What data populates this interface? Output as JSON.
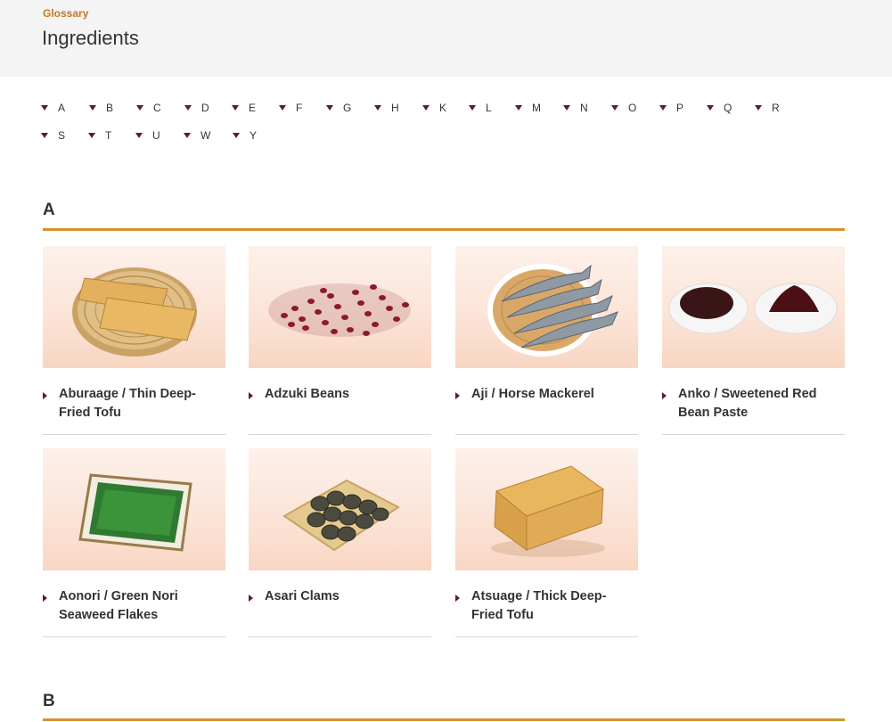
{
  "header": {
    "eyebrow": "Glossary",
    "title": "Ingredients"
  },
  "alphabet": {
    "row1": [
      "A",
      "B",
      "C",
      "D",
      "E",
      "F",
      "G",
      "H",
      "K",
      "L",
      "M",
      "N",
      "O",
      "P",
      "Q",
      "R"
    ],
    "row2": [
      "S",
      "T",
      "U",
      "W",
      "Y"
    ]
  },
  "sections": [
    {
      "letter": "A",
      "items": [
        {
          "label": "Aburaage / Thin Deep-Fried Tofu",
          "image": "aburaage-photo"
        },
        {
          "label": "Adzuki Beans",
          "image": "adzuki-photo"
        },
        {
          "label": "Aji / Horse Mackerel",
          "image": "aji-photo"
        },
        {
          "label": "Anko / Sweetened Red Bean Paste",
          "image": "anko-photo"
        },
        {
          "label": "Aonori / Green Nori Seaweed Flakes",
          "image": "aonori-photo"
        },
        {
          "label": "Asari Clams",
          "image": "asari-photo"
        },
        {
          "label": "Atsuage / Thick Deep-Fried Tofu",
          "image": "atsuage-photo"
        }
      ]
    },
    {
      "letter": "B",
      "items": []
    }
  ],
  "colors": {
    "accent": "#d8922c",
    "eyebrow": "#c8761e",
    "marker": "#5a1f24"
  }
}
